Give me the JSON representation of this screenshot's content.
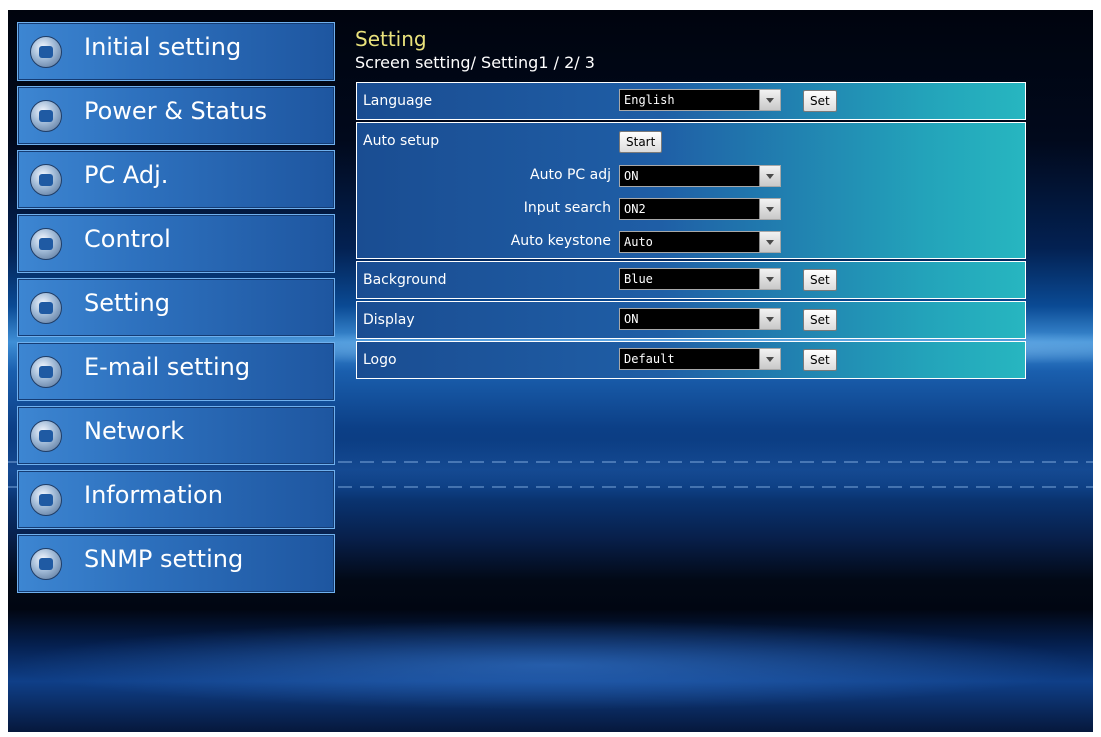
{
  "sidebar": {
    "items": [
      {
        "label": "Initial setting"
      },
      {
        "label": "Power & Status"
      },
      {
        "label": "PC Adj."
      },
      {
        "label": "Control"
      },
      {
        "label": "Setting"
      },
      {
        "label": "E-mail setting"
      },
      {
        "label": "Network"
      },
      {
        "label": "Information"
      },
      {
        "label": "SNMP setting"
      }
    ]
  },
  "header": {
    "title": "Setting",
    "subtitle": "Screen setting/ Setting1 / 2/ 3"
  },
  "settings": {
    "language": {
      "label": "Language",
      "value": "English",
      "button": "Set"
    },
    "auto_setup": {
      "label": "Auto setup",
      "button": "Start",
      "auto_pc_adj": {
        "label": "Auto PC adj",
        "value": "ON"
      },
      "input_search": {
        "label": "Input search",
        "value": "ON2"
      },
      "auto_keystone": {
        "label": "Auto keystone",
        "value": "Auto"
      }
    },
    "background": {
      "label": "Background",
      "value": "Blue",
      "button": "Set"
    },
    "display": {
      "label": "Display",
      "value": "ON",
      "button": "Set"
    },
    "logo": {
      "label": "Logo",
      "value": "Default",
      "button": "Set"
    }
  },
  "colors": {
    "title": "#e9e27c",
    "nav_button": "#2d70bd",
    "row_gradient_end": "#27b6c0"
  }
}
